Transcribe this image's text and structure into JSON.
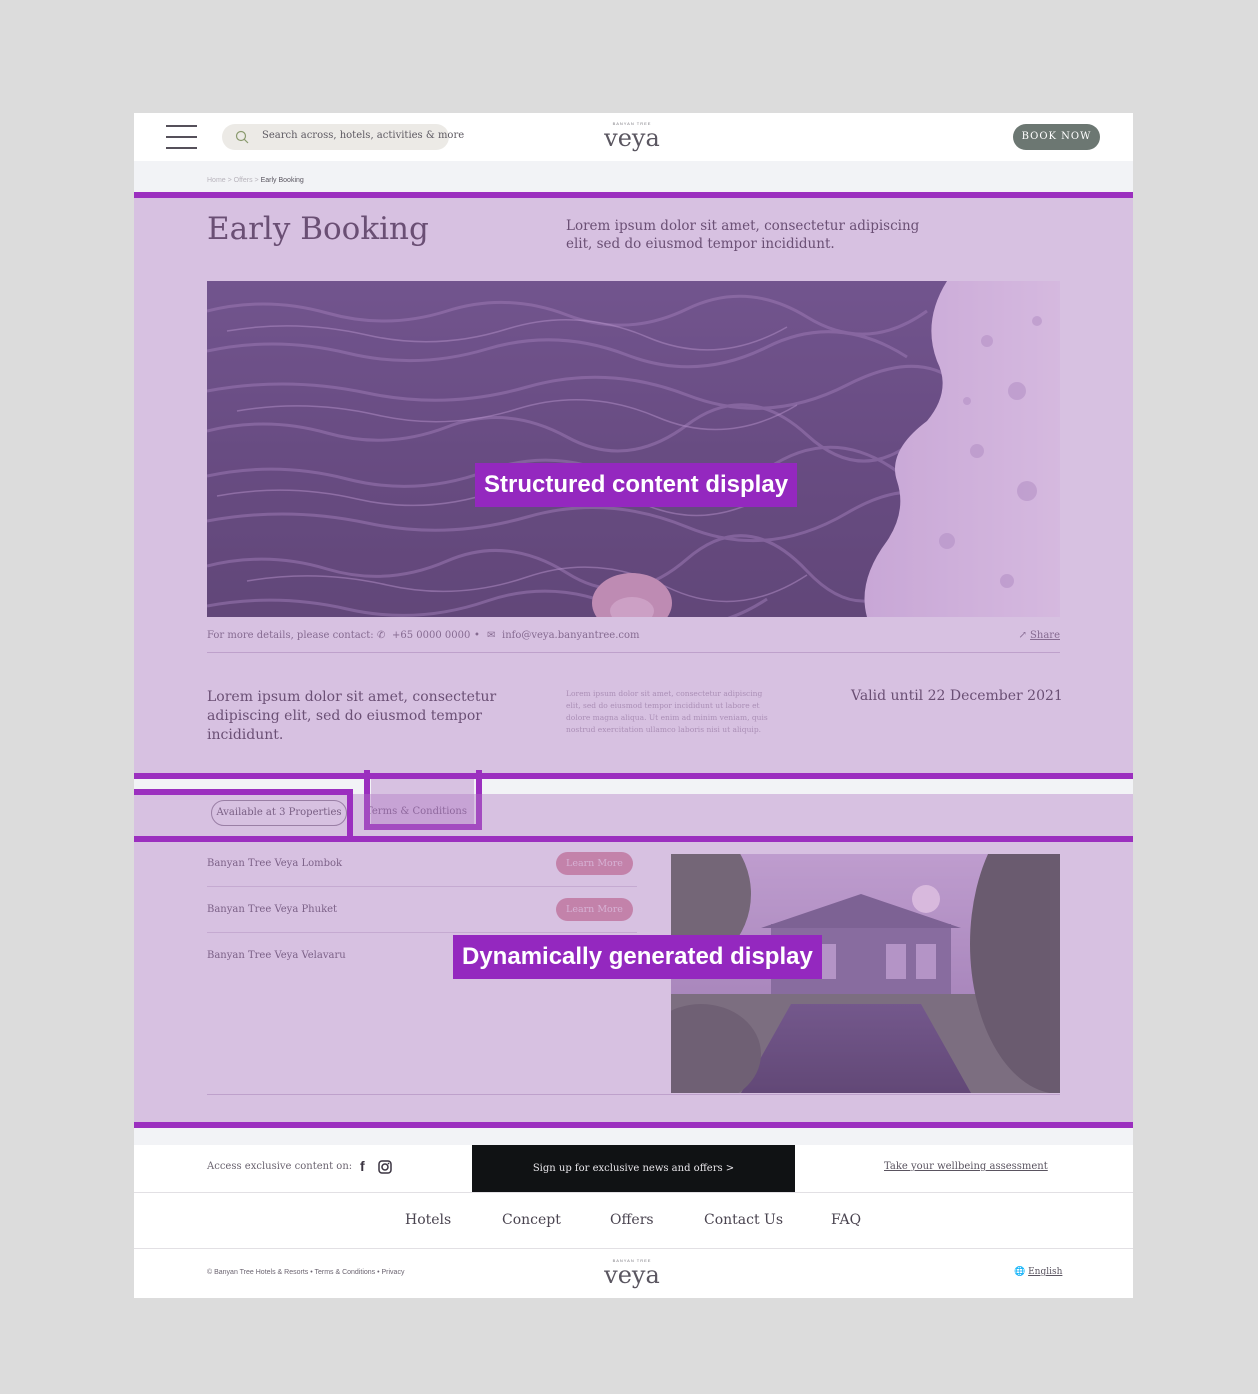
{
  "header": {
    "search_placeholder": "Search across, hotels, activities & more",
    "logo_small": "BANYAN TREE",
    "logo": "veya",
    "book_now": "BOOK NOW"
  },
  "breadcrumb": {
    "home": "Home",
    "sep1": " > ",
    "offers": "Offers",
    "sep2": " > ",
    "current": "Early Booking"
  },
  "offer": {
    "title": "Early Booking",
    "intro": "Lorem ipsum dolor sit amet, consectetur adipiscing elit, sed do eiusmod tempor incididunt.",
    "contact_label": "For more details, please contact:",
    "phone": "+65 0000 0000",
    "separator": "•",
    "email": "info@veya.banyantree.com",
    "share": "Share",
    "detail_heading": "Lorem ipsum dolor sit amet, consectetur adipiscing elit, sed do eiusmod tempor incididunt.",
    "detail_body": "Lorem ipsum dolor sit amet, consectetur adipiscing elit, sed do eiusmod tempor incididunt ut labore et dolore magna aliqua. Ut enim ad minim veniam, quis nostrud exercitation ullamco laboris nisi ut aliquip.",
    "valid_until": "Valid until 22 December 2021"
  },
  "tabs": {
    "properties": "Available at 3 Properties",
    "terms": "Terms & Conditions"
  },
  "properties": [
    {
      "name": "Banyan Tree Veya Lombok",
      "action": "Learn More"
    },
    {
      "name": "Banyan Tree Veya Phuket",
      "action": "Learn More"
    },
    {
      "name": "Banyan Tree Veya Velavaru"
    }
  ],
  "annotations": {
    "structured": "Structured content display",
    "dynamic": "Dynamically generated display"
  },
  "footer": {
    "social_label": "Access exclusive content on:",
    "newsletter": "Sign up for exclusive news and offers  >",
    "wellbeing": "Take your wellbeing assessment",
    "nav": [
      "Hotels",
      "Concept",
      "Offers",
      "Contact Us",
      "FAQ"
    ],
    "copyright": "© Banyan Tree Hotels & Resorts  •  Terms & Conditions  •  Privacy",
    "language": "English"
  },
  "colors": {
    "overlay_border": "#9b2fbf",
    "annotation_bg": "#9428bf",
    "book_now_bg": "#6c7772",
    "learn_more_bg": "#d18a99"
  }
}
